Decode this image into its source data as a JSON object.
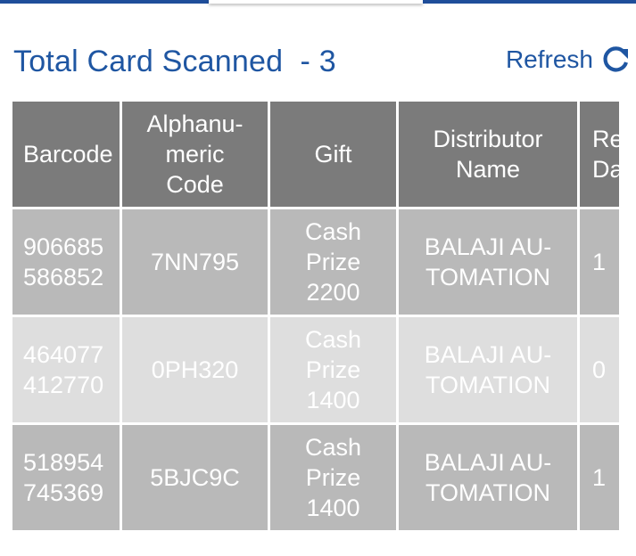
{
  "tabs": {
    "active_index": 1,
    "accent_color": "#1f4e9a"
  },
  "header": {
    "title": "Total Card Scanned  - 3",
    "refresh_label": "Refresh",
    "refresh_icon": "refresh-icon"
  },
  "table": {
    "columns": [
      "Barcode",
      "Alphanu-\nmeric\nCode",
      "Gift",
      "Distributor\nName",
      "Re\nDa"
    ],
    "rows": [
      {
        "barcode": "906685\n586852",
        "code": "7NN795",
        "gift": "Cash\nPrize\n2200",
        "distributor": "BALAJI AU-\nTOMATION",
        "partial": "1"
      },
      {
        "barcode": "464077\n412770",
        "code": "0PH320",
        "gift": "Cash\nPrize\n1400",
        "distributor": "BALAJI AU-\nTOMATION",
        "partial": "0"
      },
      {
        "barcode": "518954\n745369",
        "code": "5BJC9C",
        "gift": "Cash\nPrize\n1400",
        "distributor": "BALAJI AU-\nTOMATION",
        "partial": "1"
      }
    ],
    "colors": {
      "header_bg": "#7b7b7b",
      "row_dark_bg": "#b9b9b9",
      "row_light_bg": "#dedede"
    }
  }
}
